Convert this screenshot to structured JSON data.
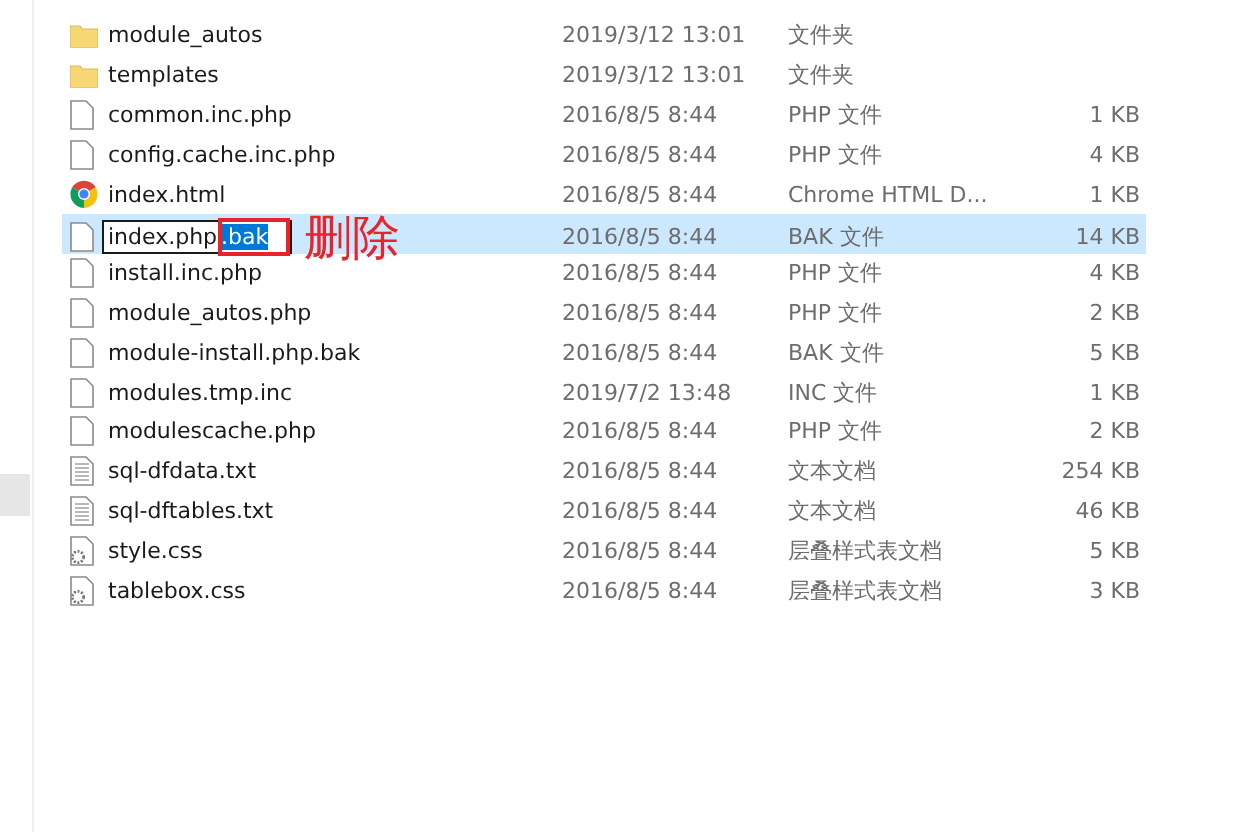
{
  "files": [
    {
      "name": "module_autos",
      "modified": "2019/3/12 13:01",
      "type": "文件夹",
      "kind": "folder",
      "selected": false
    },
    {
      "name": "templates",
      "modified": "2019/3/12 13:01",
      "type": "文件夹",
      "kind": "folder",
      "selected": false
    },
    {
      "name": "common.inc.php",
      "modified": "2016/8/5 8:44",
      "type": "PHP 文件",
      "size": "1 KB",
      "kind": "file",
      "selected": false
    },
    {
      "name": "config.cache.inc.php",
      "modified": "2016/8/5 8:44",
      "type": "PHP 文件",
      "size": "4 KB",
      "kind": "file",
      "selected": false
    },
    {
      "name": "index.html",
      "modified": "2016/8/5 8:44",
      "type": "Chrome HTML D...",
      "size": "1 KB",
      "kind": "browser",
      "selected": false
    },
    {
      "name": "index.php",
      "rename_highlight": ".bak",
      "annotation": "删除",
      "modified": "2016/8/5 8:44",
      "type": "BAK 文件",
      "size": "14 KB",
      "kind": "file",
      "selected": true
    },
    {
      "name": "install.inc.php",
      "modified": "2016/8/5 8:44",
      "type": "PHP 文件",
      "size": "4 KB",
      "kind": "file",
      "selected": false
    },
    {
      "name": "module_autos.php",
      "modified": "2016/8/5 8:44",
      "type": "PHP 文件",
      "size": "2 KB",
      "kind": "file",
      "selected": false
    },
    {
      "name": "module-install.php.bak",
      "modified": "2016/8/5 8:44",
      "type": "BAK 文件",
      "size": "5 KB",
      "kind": "file",
      "selected": false
    },
    {
      "name": "modules.tmp.inc",
      "modified": "2019/7/2 13:48",
      "type": "INC 文件",
      "size": "1 KB",
      "kind": "file",
      "selected": false
    },
    {
      "name": "modulescache.php",
      "modified": "2016/8/5 8:44",
      "type": "PHP 文件",
      "size": "2 KB",
      "kind": "file",
      "selected": false
    },
    {
      "name": "sql-dfdata.txt",
      "modified": "2016/8/5 8:44",
      "type": "文本文档",
      "size": "254 KB",
      "kind": "text",
      "selected": false
    },
    {
      "name": "sql-dftables.txt",
      "modified": "2016/8/5 8:44",
      "type": "文本文档",
      "size": "46 KB",
      "kind": "text",
      "selected": false
    },
    {
      "name": "style.css",
      "modified": "2016/8/5 8:44",
      "type": "层叠样式表文档",
      "size": "5 KB",
      "kind": "css",
      "selected": false
    },
    {
      "name": "tablebox.css",
      "modified": "2016/8/5 8:44",
      "type": "层叠样式表文档",
      "size": "3 KB",
      "kind": "css",
      "selected": false
    }
  ]
}
